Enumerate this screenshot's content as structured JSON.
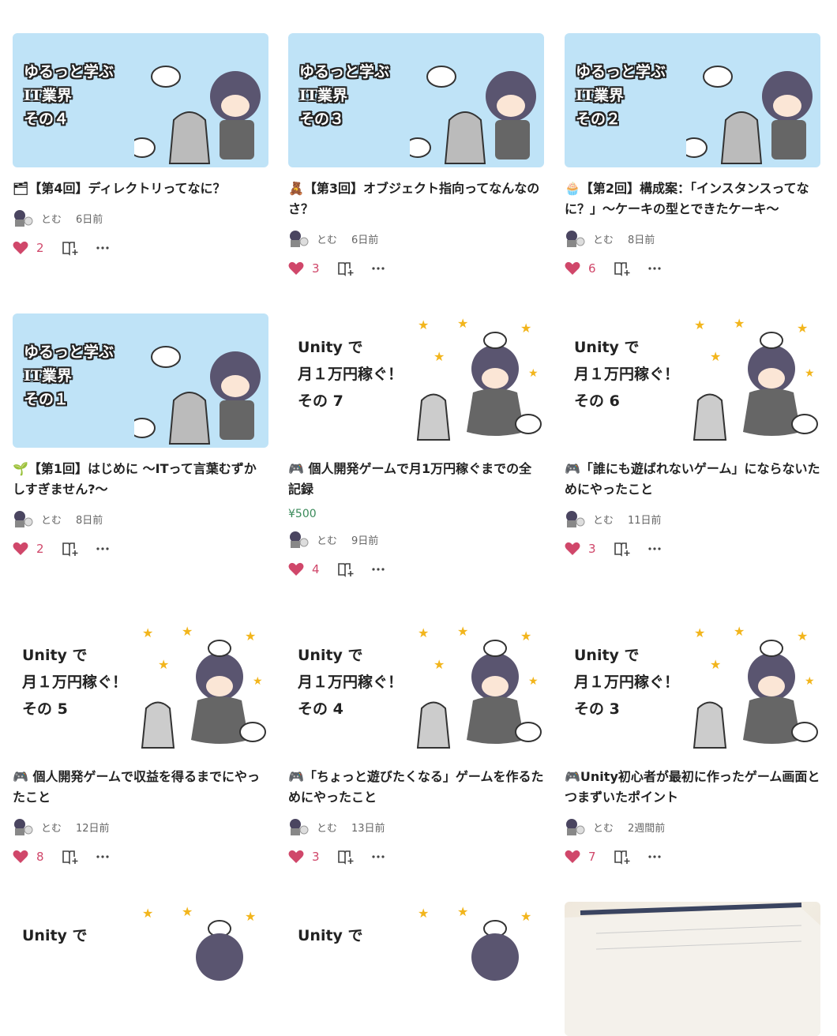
{
  "cards": [
    {
      "thumb_text": "ゆるっと学ぶ\nIT業界\nその４",
      "title": "🗂【第4回】ディレクトリってなに？",
      "author": "とむ",
      "date": "6日前",
      "likes": "2"
    },
    {
      "thumb_text": "ゆるっと学ぶ\nIT業界\nその３",
      "title": "🧸【第3回】オブジェクト指向ってなんなのさ？",
      "author": "とむ",
      "date": "6日前",
      "likes": "3"
    },
    {
      "thumb_text": "ゆるっと学ぶ\nIT業界\nその２",
      "title": "🧁【第2回】構成案：「インスタンスってなに？」〜ケーキの型とできたケーキ〜",
      "author": "とむ",
      "date": "8日前",
      "likes": "6"
    },
    {
      "thumb_text": "ゆるっと学ぶ\nIT業界\nその１",
      "title": "🌱【第1回】はじめに 〜ITって言葉むずかしすぎません?〜",
      "author": "とむ",
      "date": "8日前",
      "likes": "2"
    },
    {
      "thumb_text": "Unity で\n月１万円稼ぐ！\nその 7",
      "title": "🎮 個人開発ゲームで月1万円稼ぐまでの全記録",
      "price": "¥500",
      "author": "とむ",
      "date": "9日前",
      "likes": "4"
    },
    {
      "thumb_text": "Unity で\n月１万円稼ぐ！\nその 6",
      "title": "🎮「誰にも遊ばれないゲーム」にならないためにやったこと",
      "author": "とむ",
      "date": "11日前",
      "likes": "3"
    },
    {
      "thumb_text": "Unity で\n月１万円稼ぐ！\nその 5",
      "title": "🎮 個人開発ゲームで収益を得るまでにやったこと",
      "author": "とむ",
      "date": "12日前",
      "likes": "8"
    },
    {
      "thumb_text": "Unity で\n月１万円稼ぐ！\nその 4",
      "title": "🎮「ちょっと遊びたくなる」ゲームを作るためにやったこと",
      "author": "とむ",
      "date": "13日前",
      "likes": "3"
    },
    {
      "thumb_text": "Unity で\n月１万円稼ぐ！\nその 3",
      "title": "🎮Unity初心者が最初に作ったゲーム画面とつまずいたポイント",
      "author": "とむ",
      "date": "2週間前",
      "likes": "7"
    },
    {
      "thumb_text": "Unity で"
    },
    {
      "thumb_text": "Unity で"
    },
    {}
  ],
  "colors": {
    "like": "#d0476a",
    "thumb_blue": "#bfe3f7",
    "price": "#3a8a5a"
  }
}
